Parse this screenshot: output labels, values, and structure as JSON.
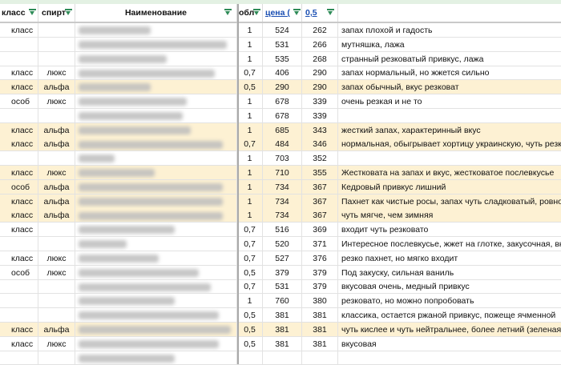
{
  "headers": {
    "klass": "класс",
    "spirt": "спирт",
    "name": "Наименование",
    "obl": "обл",
    "price": "цена (",
    "half": "0,5",
    "comment": ""
  },
  "rows": [
    {
      "klass": "класс",
      "spirt": "",
      "obl": "1",
      "price": "524",
      "half": "262",
      "comment": "запах плохой и гадость",
      "hl": false,
      "bw": 90
    },
    {
      "klass": "",
      "spirt": "",
      "obl": "1",
      "price": "531",
      "half": "266",
      "comment": "мутняшка, лажа",
      "hl": false,
      "bw": 185
    },
    {
      "klass": "",
      "spirt": "",
      "obl": "1",
      "price": "535",
      "half": "268",
      "comment": "странный резковатый привкус, лажа",
      "hl": false,
      "bw": 110
    },
    {
      "klass": "класс",
      "spirt": "люкс",
      "obl": "0,7",
      "price": "406",
      "half": "290",
      "comment": "запах нормальный, но жжется сильно",
      "hl": false,
      "bw": 170
    },
    {
      "klass": "класс",
      "spirt": "альфа",
      "obl": "0,5",
      "price": "290",
      "half": "290",
      "comment": "запах обычный, вкус резковат",
      "hl": true,
      "bw": 90
    },
    {
      "klass": "особ",
      "spirt": "люкс",
      "obl": "1",
      "price": "678",
      "half": "339",
      "comment": "очень резкая и не то",
      "hl": false,
      "bw": 135
    },
    {
      "klass": "",
      "spirt": "",
      "obl": "1",
      "price": "678",
      "half": "339",
      "comment": "",
      "hl": false,
      "bw": 130
    },
    {
      "klass": "класс",
      "spirt": "альфа",
      "obl": "1",
      "price": "685",
      "half": "343",
      "comment": "жесткий запах, характеринный вкус",
      "hl": true,
      "bw": 140
    },
    {
      "klass": "класс",
      "spirt": "альфа",
      "obl": "0,7",
      "price": "484",
      "half": "346",
      "comment": "нормальная, обыгрывает хортицу украинскую, чуть резкость",
      "hl": true,
      "bw": 180
    },
    {
      "klass": "",
      "spirt": "",
      "obl": "1",
      "price": "703",
      "half": "352",
      "comment": "",
      "hl": false,
      "bw": 45
    },
    {
      "klass": "класс",
      "spirt": "люкс",
      "obl": "1",
      "price": "710",
      "half": "355",
      "comment": "Жестковата на запах и вкус, жестковатое послевкусье",
      "hl": true,
      "bw": 95
    },
    {
      "klass": "особ",
      "spirt": "альфа",
      "obl": "1",
      "price": "734",
      "half": "367",
      "comment": "Кедровый привкус лишний",
      "hl": true,
      "bw": 180
    },
    {
      "klass": "класс",
      "spirt": "альфа",
      "obl": "1",
      "price": "734",
      "half": "367",
      "comment": "Пахнет как чистые росы, запах чуть сладковатый, ровное жжение",
      "hl": true,
      "bw": 180
    },
    {
      "klass": "класс",
      "spirt": "альфа",
      "obl": "1",
      "price": "734",
      "half": "367",
      "comment": "чуть мягче, чем зимняя",
      "hl": true,
      "bw": 180
    },
    {
      "klass": "класс",
      "spirt": "",
      "obl": "0,7",
      "price": "516",
      "half": "369",
      "comment": "входит чуть резковато",
      "hl": false,
      "bw": 120
    },
    {
      "klass": "",
      "spirt": "",
      "obl": "0,7",
      "price": "520",
      "half": "371",
      "comment": "Интересное послевкусье, жжет на глотке, закусочная, вкусовая",
      "hl": false,
      "bw": 60
    },
    {
      "klass": "класс",
      "spirt": "люкс",
      "obl": "0,7",
      "price": "527",
      "half": "376",
      "comment": "резко пахнет, но мягко входит",
      "hl": false,
      "bw": 100
    },
    {
      "klass": "особ",
      "spirt": "люкс",
      "obl": "0,5",
      "price": "379",
      "half": "379",
      "comment": "Под закуску, сильная ваниль",
      "hl": false,
      "bw": 150
    },
    {
      "klass": "",
      "spirt": "",
      "obl": "0,7",
      "price": "531",
      "half": "379",
      "comment": "вкусовая очень, медный привкус",
      "hl": false,
      "bw": 165
    },
    {
      "klass": "",
      "spirt": "",
      "obl": "1",
      "price": "760",
      "half": "380",
      "comment": "резковато, но можно попробовать",
      "hl": false,
      "bw": 120
    },
    {
      "klass": "",
      "spirt": "",
      "obl": "0,5",
      "price": "381",
      "half": "381",
      "comment": "классика, остается ржаной привкус, пожеще ячменной",
      "hl": false,
      "bw": 175
    },
    {
      "klass": "класс",
      "spirt": "альфа",
      "obl": "0,5",
      "price": "381",
      "half": "381",
      "comment": "чуть кислее и чуть нейтральнее, более летний (зеленая)",
      "hl": true,
      "bw": 190
    },
    {
      "klass": "класс",
      "spirt": "люкс",
      "obl": "0,5",
      "price": "381",
      "half": "381",
      "comment": "вкусовая",
      "hl": false,
      "bw": 175
    },
    {
      "klass": "",
      "spirt": "",
      "obl": "",
      "price": "",
      "half": "",
      "comment": "",
      "hl": false,
      "bw": 120
    }
  ]
}
